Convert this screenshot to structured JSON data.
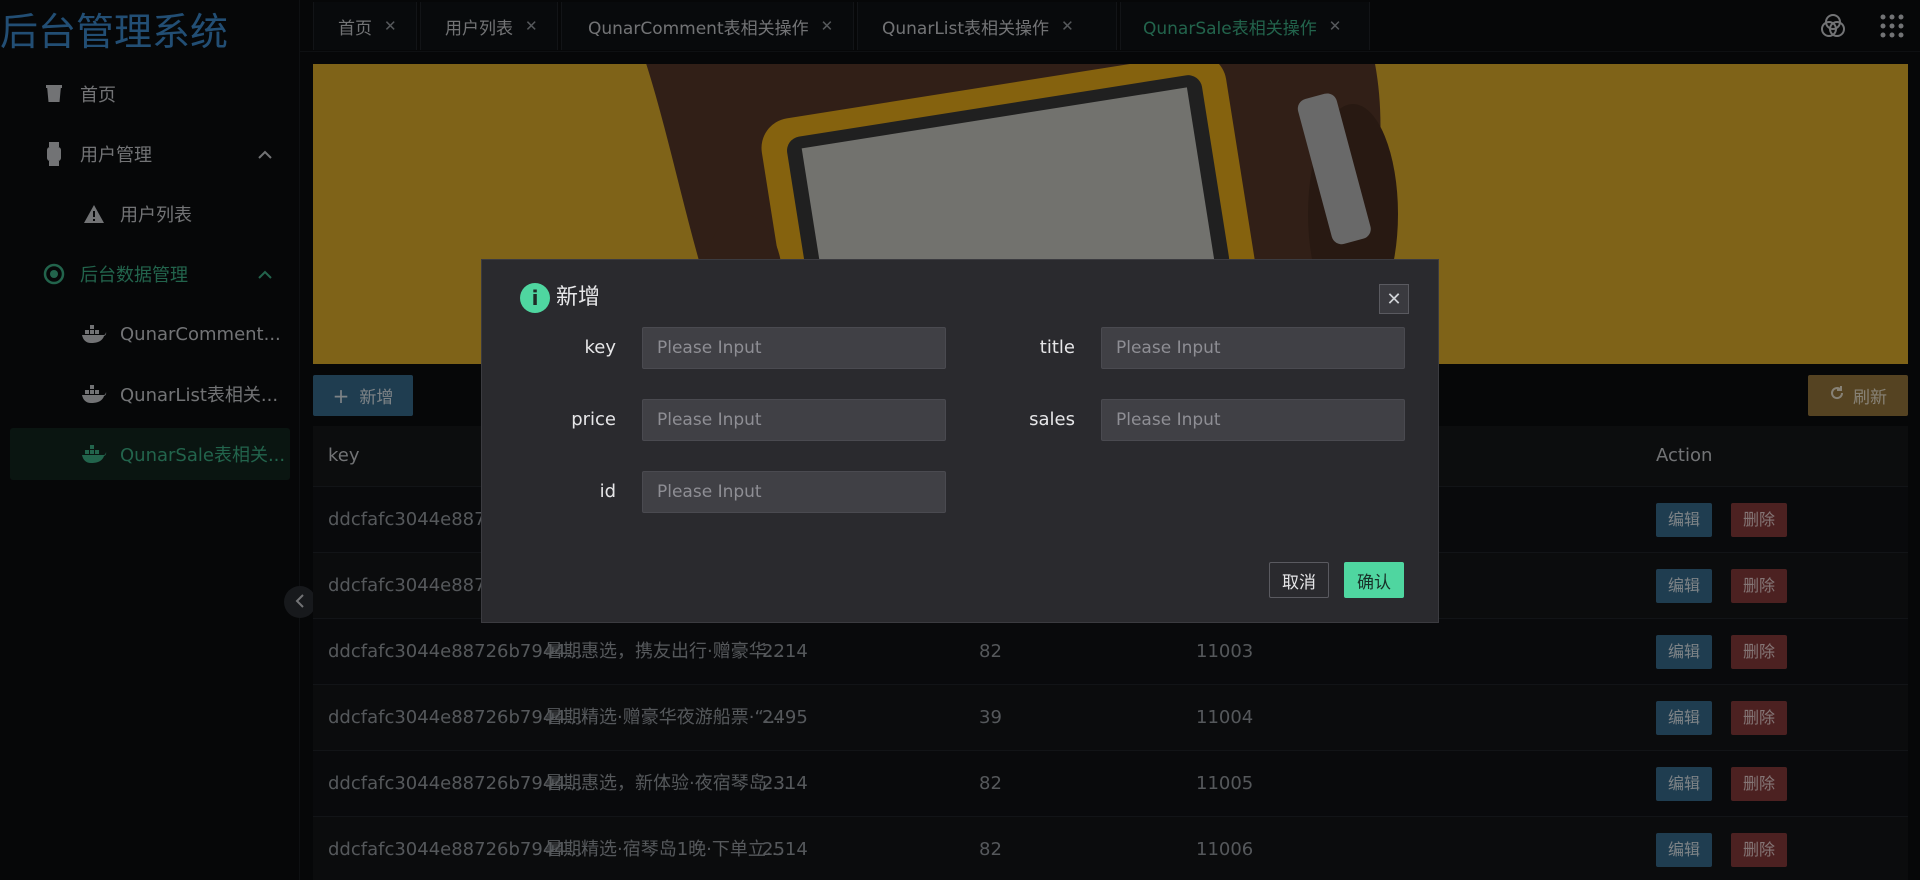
{
  "app": {
    "brand": "后台管理系统"
  },
  "sidebar": {
    "items": [
      {
        "label": "首页"
      },
      {
        "label": "用户管理"
      },
      {
        "label": "用户列表"
      },
      {
        "label": "后台数据管理"
      },
      {
        "label": "QunarComment..."
      },
      {
        "label": "QunarList表相关..."
      },
      {
        "label": "QunarSale表相关..."
      }
    ]
  },
  "tabs": [
    {
      "label": "首页"
    },
    {
      "label": "用户列表"
    },
    {
      "label": "QunarComment表相关操作"
    },
    {
      "label": "QunarList表相关操作"
    },
    {
      "label": "QunarSale表相关操作"
    }
  ],
  "toolbar": {
    "add_label": "新增",
    "refresh_label": "刷新"
  },
  "table": {
    "columns": [
      "key",
      "Action"
    ],
    "rows": [
      {
        "key": "ddcfafc3044e8872",
        "title": "",
        "price": "",
        "sales": "",
        "id": ""
      },
      {
        "key": "ddcfafc3044e8872",
        "title": "",
        "price": "",
        "sales": "",
        "id": ""
      },
      {
        "key": "ddcfafc3044e88726b7944...",
        "title": "暑期惠选，携友出行·赠豪华...",
        "price": "2214",
        "sales": "82",
        "id": "11003"
      },
      {
        "key": "ddcfafc3044e88726b7944...",
        "title": "暑期精选·赠豪华夜游船票·“...",
        "price": "2495",
        "sales": "39",
        "id": "11004"
      },
      {
        "key": "ddcfafc3044e88726b7944...",
        "title": "暑期惠选，新体验·夜宿琴岛·...",
        "price": "2314",
        "sales": "82",
        "id": "11005"
      },
      {
        "key": "ddcfafc3044e88726b7944...",
        "title": "暑期精选·宿琴岛1晚·下单立...",
        "price": "2514",
        "sales": "82",
        "id": "11006"
      }
    ],
    "edit_label": "编辑",
    "delete_label": "删除"
  },
  "dialog": {
    "title": "新增",
    "fields": {
      "key": {
        "label": "key",
        "placeholder": "Please Input",
        "value": ""
      },
      "title": {
        "label": "title",
        "placeholder": "Please Input",
        "value": ""
      },
      "price": {
        "label": "price",
        "placeholder": "Please Input",
        "value": ""
      },
      "sales": {
        "label": "sales",
        "placeholder": "Please Input",
        "value": ""
      },
      "id": {
        "label": "id",
        "placeholder": "Please Input",
        "value": ""
      }
    },
    "cancel_label": "取消",
    "confirm_label": "确认"
  },
  "colors": {
    "accent": "#3fb68b",
    "primary": "#3a6f93",
    "danger": "#8a3c3c",
    "warning": "#9b7b3f",
    "brand": "#3f8fd4"
  }
}
